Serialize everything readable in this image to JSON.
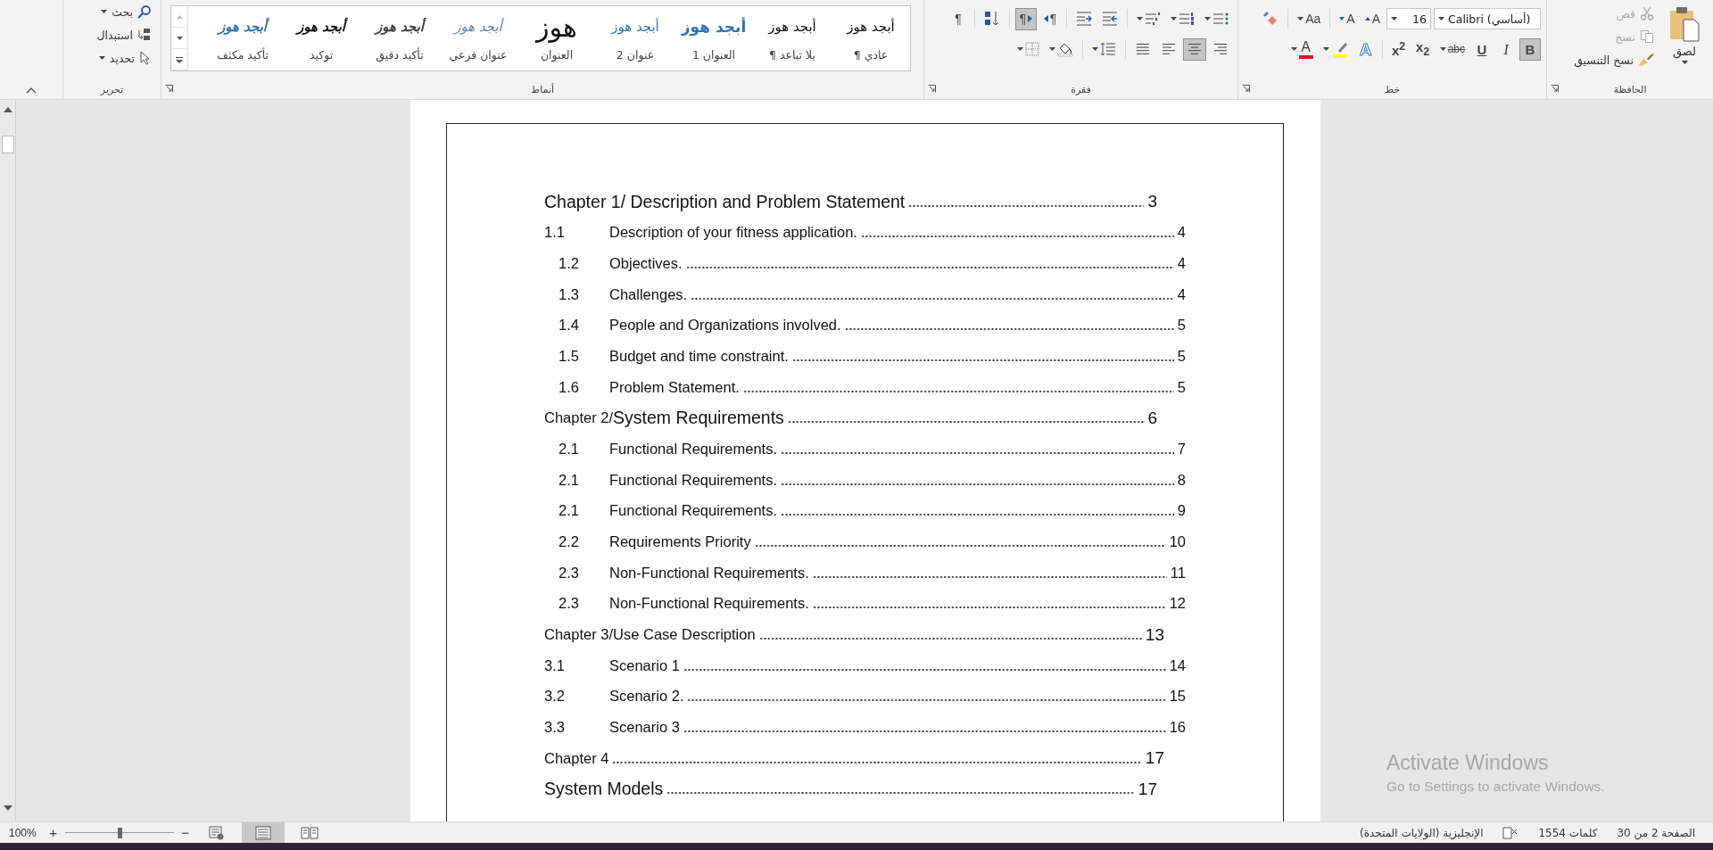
{
  "ribbon": {
    "clipboard": {
      "label": "الحافظة",
      "paste": "لصق",
      "cut": {
        "label": "قص",
        "disabled": true
      },
      "copy": {
        "label": "نسخ",
        "disabled": true
      },
      "format_painter": {
        "label": "نسخ التنسيق",
        "disabled": false
      }
    },
    "font": {
      "label": "خط",
      "font_name": "Calibri (أساسي)",
      "font_size": "16",
      "row1": [
        {
          "kind": "grow",
          "text": "A"
        },
        {
          "kind": "shrink",
          "text": "A"
        },
        {
          "kind": "case",
          "text": "Aa"
        },
        {
          "kind": "clear"
        }
      ],
      "row2": [
        {
          "kind": "bold",
          "text": "B",
          "selected": true
        },
        {
          "kind": "italic",
          "text": "I",
          "selected": false
        },
        {
          "kind": "underline",
          "text": "U",
          "selected": false
        },
        {
          "kind": "strike",
          "text": "abc",
          "selected": false
        },
        {
          "kind": "subscript",
          "text": "x$_{2}$",
          "selected": false
        },
        {
          "kind": "superscript",
          "text": "x$^{2}$",
          "selected": false
        },
        {
          "kind": "effects",
          "text": "A"
        },
        {
          "kind": "highlight",
          "color": "#ffff00"
        },
        {
          "kind": "font-color",
          "text": "A",
          "color": "#e81123"
        }
      ]
    },
    "paragraph": {
      "label": "فقرة",
      "row1": [
        {
          "kind": "bullets"
        },
        {
          "kind": "numbering"
        },
        {
          "kind": "multilevel"
        },
        {
          "kind": "decrease-indent"
        },
        {
          "kind": "increase-indent"
        },
        {
          "kind": "rtl",
          "text": "¶",
          "selected": false
        },
        {
          "kind": "ltr",
          "text": "¶",
          "selected": true
        },
        {
          "kind": "sort"
        },
        {
          "kind": "show-marks",
          "text": "¶",
          "selected": false
        }
      ],
      "row2": [
        {
          "kind": "align-right",
          "selected": false
        },
        {
          "kind": "align-center",
          "selected": true
        },
        {
          "kind": "align-left",
          "selected": false
        },
        {
          "kind": "justify",
          "selected": false
        },
        {
          "kind": "line-spacing"
        },
        {
          "kind": "shading"
        },
        {
          "kind": "borders"
        }
      ]
    },
    "styles": {
      "label": "أنماط",
      "items": [
        {
          "kind": "normal",
          "preview": "أبجد هوز",
          "name": "عادي ¶",
          "selected": false
        },
        {
          "kind": "no-spacing",
          "preview": "أبجد هوز",
          "name": "بلا تباعد ¶",
          "selected": false
        },
        {
          "kind": "heading1",
          "preview": "أبجد هوز",
          "name": "العنوان 1",
          "selected": false
        },
        {
          "kind": "heading2",
          "preview": "أبجد هوز",
          "name": "عنوان 2",
          "selected": false
        },
        {
          "kind": "title",
          "preview": "هوز",
          "name": "العنوان",
          "selected": false
        },
        {
          "kind": "subtitle",
          "preview": "أبجد هوز",
          "name": "عنوان فرعي",
          "selected": false
        },
        {
          "kind": "subtle-emphasis",
          "preview": "أبجد هوز",
          "name": "تأكيد دقيق",
          "selected": false
        },
        {
          "kind": "emphasis",
          "preview": "أبجد هوز",
          "name": "توكيد",
          "selected": false
        },
        {
          "kind": "intense-emphasis",
          "preview": "أبجد هوز",
          "name": "تأكيد مكثف",
          "selected": false
        }
      ]
    },
    "editing": {
      "label": "تحرير",
      "find": "بحث",
      "replace": "استبدال",
      "select": "تحديد"
    }
  },
  "document": {
    "toc": [
      {
        "kind": "heading",
        "title": "Chapter 1/ Description and Problem Statement",
        "page": "3"
      },
      {
        "kind": "entry",
        "number": "1.1",
        "title": "Description of your fitness application.",
        "page": "4",
        "indented": false
      },
      {
        "kind": "entry",
        "number": "1.2",
        "title": "Objectives.",
        "page": "4",
        "indented": true
      },
      {
        "kind": "entry",
        "number": "1.3",
        "title": "Challenges.",
        "page": "4",
        "indented": true
      },
      {
        "kind": "entry",
        "number": "1.4",
        "title": "People and Organizations involved.",
        "page": "5",
        "indented": true
      },
      {
        "kind": "entry",
        "number": "1.5",
        "title": "Budget and time constraint.",
        "page": "5",
        "indented": true
      },
      {
        "kind": "entry",
        "number": "1.6",
        "title": "Problem Statement.",
        "page": "5",
        "indented": true
      },
      {
        "kind": "heading",
        "prefix": "Chapter 2/",
        "title": "System Requirements",
        "page": "6"
      },
      {
        "kind": "entry",
        "number": "2.1",
        "title": "Functional Requirements.",
        "page": "7",
        "indented": true
      },
      {
        "kind": "entry",
        "number": "2.1",
        "title": "Functional Requirements.",
        "page": "8",
        "indented": true
      },
      {
        "kind": "entry",
        "number": "2.1",
        "title": "Functional Requirements.",
        "page": "9",
        "indented": true
      },
      {
        "kind": "entry",
        "number": "2.2",
        "title": "Requirements Priority",
        "page": "10",
        "indented": true
      },
      {
        "kind": "entry",
        "number": "2.3",
        "title": "Non-Functional Requirements.",
        "page": "11",
        "indented": true
      },
      {
        "kind": "entry",
        "number": "2.3",
        "title": "Non-Functional Requirements.",
        "page": "12",
        "indented": true
      },
      {
        "kind": "minor-heading",
        "title": "Chapter 3/Use Case Description",
        "page": "13"
      },
      {
        "kind": "entry",
        "number": "3.1",
        "title": "Scenario 1",
        "page": "14",
        "indented": false
      },
      {
        "kind": "entry",
        "number": "3.2",
        "title": "Scenario 2.",
        "page": "15",
        "indented": false
      },
      {
        "kind": "entry",
        "number": "3.3",
        "title": "Scenario 3",
        "page": "16",
        "indented": false
      },
      {
        "kind": "minor-heading",
        "title": "Chapter 4",
        "page": "17"
      },
      {
        "kind": "heading",
        "title": "System Models",
        "page": "17"
      }
    ]
  },
  "status_bar": {
    "page": "الصفحة 2 من 30",
    "words": "كلمات 1554",
    "language": "الإنجليزية (الولايات المتحدة)",
    "zoom": "100%",
    "zoom_in": "+",
    "zoom_out": "−",
    "zoom_slider": {
      "level": 0.5
    },
    "views": [
      {
        "kind": "web",
        "selected": false
      },
      {
        "kind": "print",
        "selected": true
      },
      {
        "kind": "read",
        "selected": false
      }
    ]
  },
  "activation_notice": {
    "title": "Activate Windows",
    "text": "Go to Settings to activate Windows."
  }
}
